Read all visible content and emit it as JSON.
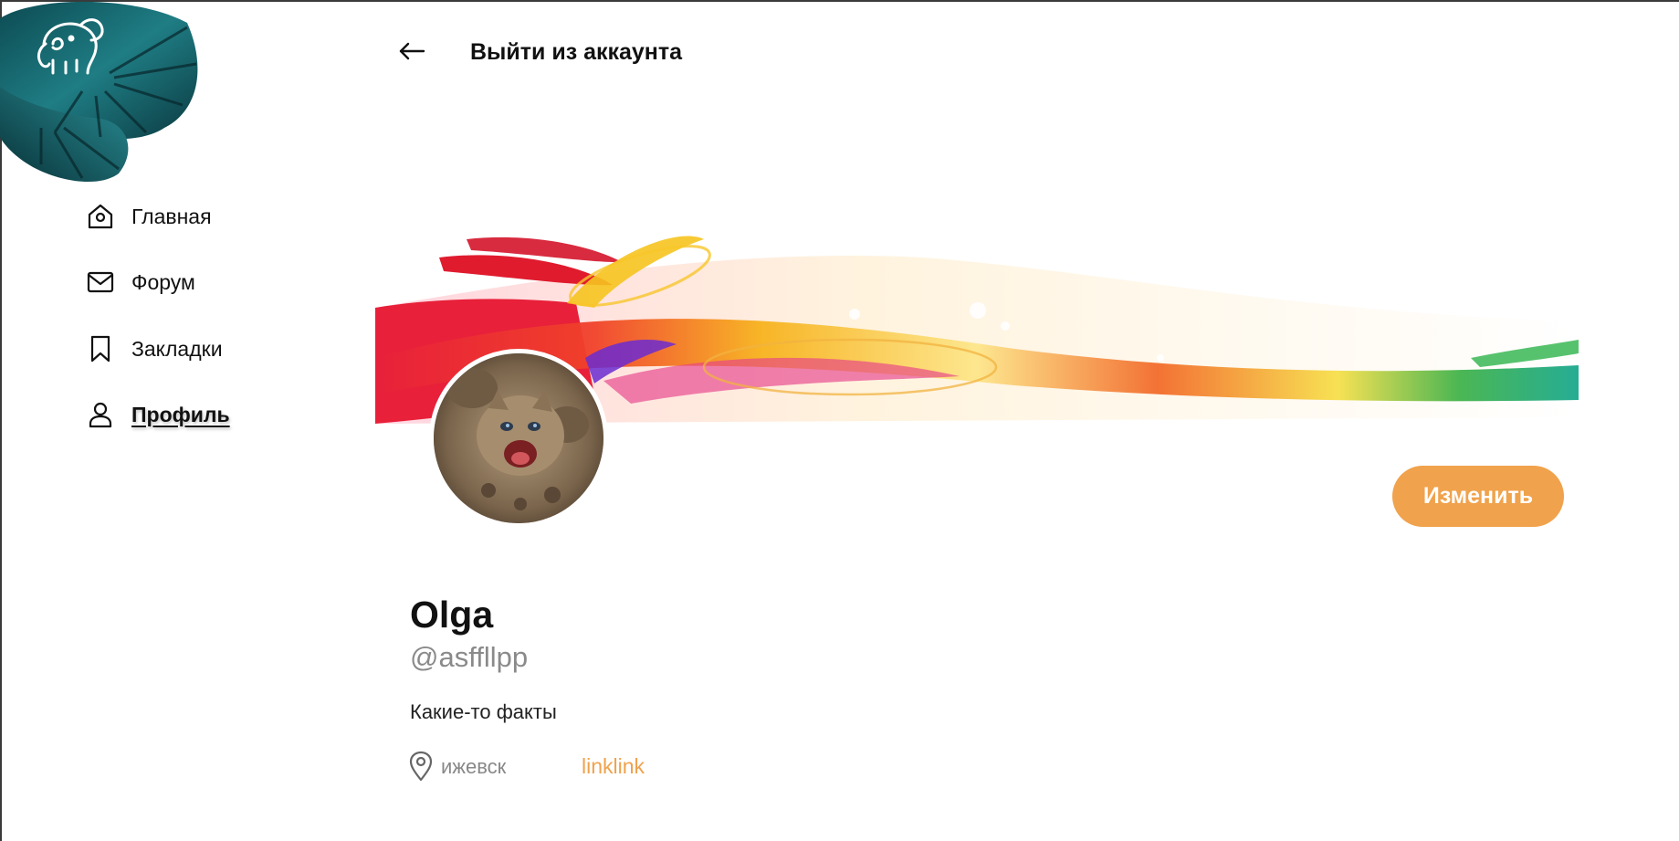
{
  "header": {
    "back_icon": "arrow-left-icon",
    "title": "Выйти из аккаунта"
  },
  "logo": {
    "icon": "elephant-leaf-logo"
  },
  "sidebar": {
    "items": [
      {
        "label": "Главная",
        "icon": "house-icon",
        "active": false
      },
      {
        "label": "Форум",
        "icon": "envelope-icon",
        "active": false
      },
      {
        "label": "Закладки",
        "icon": "bookmark-icon",
        "active": false
      },
      {
        "label": "Профиль",
        "icon": "user-icon",
        "active": true
      }
    ]
  },
  "profile": {
    "name": "Olga",
    "handle": "@asffllpp",
    "bio": "Какие-то факты",
    "location": "ижевск",
    "location_icon": "map-pin-icon",
    "link": "linklink",
    "edit_label": "Изменить"
  },
  "colors": {
    "accent": "#f0a24c",
    "muted_text": "#8a8a8a",
    "text": "#111111"
  }
}
